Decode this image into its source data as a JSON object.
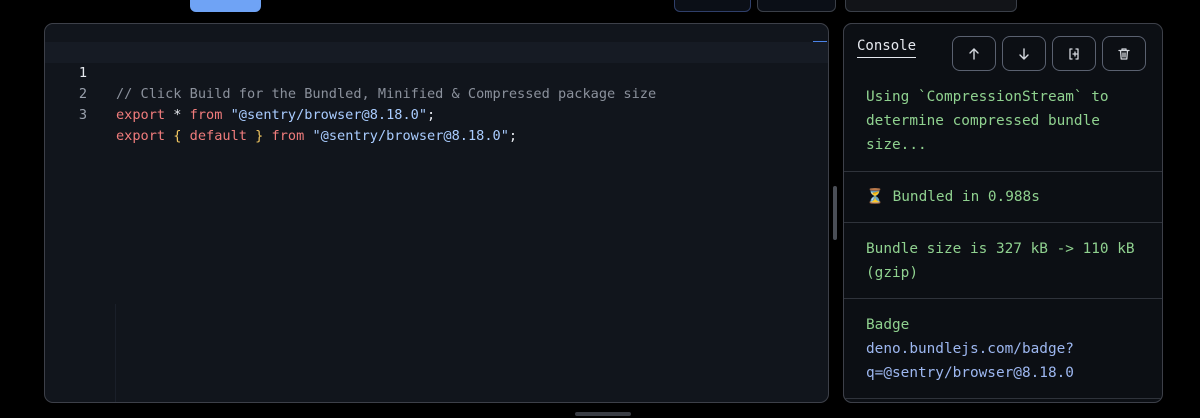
{
  "editor": {
    "lines": [
      {
        "number": "1",
        "comment": "// Click Build for the Bundled, Minified & Compressed package size"
      },
      {
        "number": "2",
        "kw_export": "export",
        "op": "*",
        "kw_from": "from",
        "string": "\"@sentry/browser@8.18.0\"",
        "semi": ";"
      },
      {
        "number": "3",
        "kw_export": "export",
        "brace_open": "{",
        "kw_default": "default",
        "brace_close": "}",
        "kw_from": "from",
        "string": "\"@sentry/browser@8.18.0\"",
        "semi": ";"
      }
    ]
  },
  "console": {
    "title": "Console",
    "buttons": [
      {
        "icon": "arrow-up-icon"
      },
      {
        "icon": "arrow-down-icon"
      },
      {
        "icon": "copy-icon"
      },
      {
        "icon": "trash-icon"
      }
    ],
    "messages": {
      "compression": "Using `CompressionStream` to determine compressed bundle size...",
      "bundled_icon": "⏳",
      "bundled": "Bundled in 0.988s",
      "size": "Bundle size is 327 kB -> 110 kB (gzip)",
      "badge_label": "Badge",
      "badge_link": "deno.bundlejs.com/badge?q=@sentry/browser@8.18.0"
    }
  },
  "colors": {
    "accent": "#6fa3f5",
    "console_text": "#8fd18f",
    "link": "#9db7f0",
    "keyword": "#f07c7c",
    "string": "#a9ccff"
  }
}
